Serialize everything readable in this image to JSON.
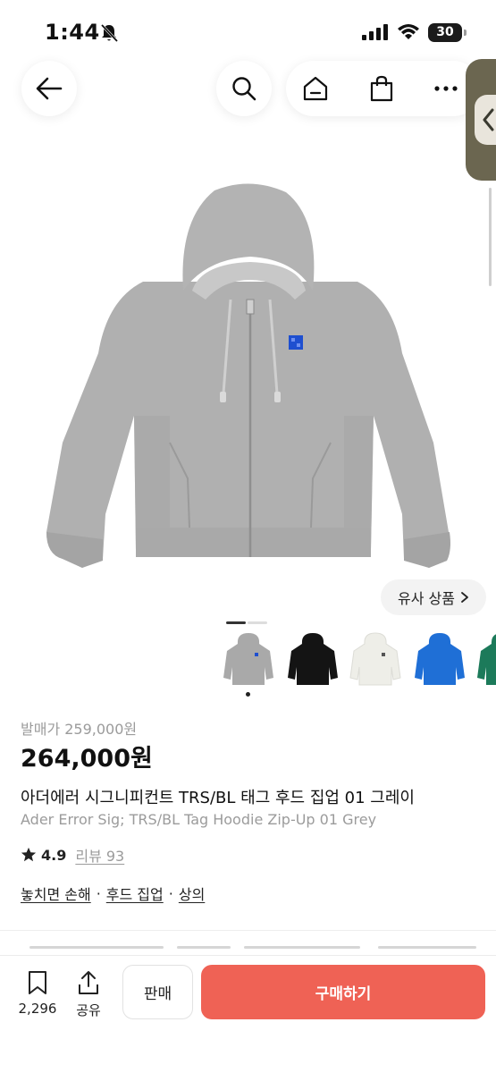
{
  "status_bar": {
    "time": "1:44",
    "battery": "30"
  },
  "nav": {
    "back_icon": "arrow-left-icon",
    "search_icon": "search-icon",
    "home_icon": "home-icon",
    "bag_icon": "shopping-bag-icon",
    "more_icon": "more-dots-icon"
  },
  "gallery": {
    "similar_label": "유사 상품",
    "current_slide": 1,
    "slide_count": 2,
    "swatch_colors": [
      "#a9a9a9",
      "#141414",
      "#eeeee8",
      "#1f6fd6",
      "#1c7a5a"
    ],
    "selected_swatch": 0
  },
  "product": {
    "release_price": "발매가 259,000원",
    "price": "264,000원",
    "title_ko": "아더에러 시그니피컨트 TRS/BL 태그 후드 집업 01 그레이",
    "title_en": "Ader Error Sig; TRS/BL Tag Hoodie Zip-Up 01 Grey",
    "rating": "4.9",
    "review_label": "리뷰 93",
    "tags": [
      "놓치면 손해",
      "후드 집업",
      "상의"
    ],
    "tag_separator": "·"
  },
  "bottom_bar": {
    "save_count": "2,296",
    "share_label": "공유",
    "sell_label": "판매",
    "buy_label": "구매하기",
    "accent_color": "#ef6255"
  }
}
